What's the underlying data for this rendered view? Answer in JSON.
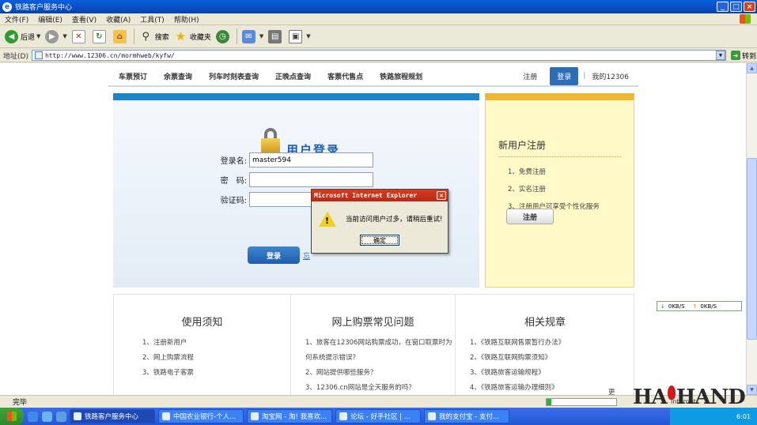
{
  "window": {
    "title": "铁路客户服务中心"
  },
  "menu": [
    "文件(F)",
    "编辑(E)",
    "查看(V)",
    "收藏(A)",
    "工具(T)",
    "帮助(H)"
  ],
  "toolbar": {
    "back": "后退",
    "search": "搜索",
    "favorites": "收藏夹"
  },
  "address": {
    "label": "地址(D)",
    "url": "http://www.12306.cn/mormhweb/kyfw/",
    "go": "转到"
  },
  "site_nav": {
    "items": [
      "车票预订",
      "余票查询",
      "列车时刻表查询",
      "正晚点查询",
      "客票代售点",
      "铁路旅程规划"
    ],
    "register": "注册",
    "login": "登录",
    "divider": "|",
    "my": "我的12306"
  },
  "login": {
    "title": "用户登录",
    "username_label": "登录名:",
    "username_value": "master594",
    "password_label": "密　码:",
    "captcha_label": "验证码:",
    "submit": "登录",
    "forgot": "忘"
  },
  "register_panel": {
    "title": "新用户注册",
    "steps": [
      "1、免费注册",
      "2、实名注册",
      "3、注册用户可享受个性化服务"
    ],
    "button": "注册"
  },
  "info": {
    "col1": {
      "title": "使用须知",
      "items": [
        "1、注册新用户",
        "2、网上购票流程",
        "3、铁路电子客票"
      ]
    },
    "col2": {
      "title": "网上购票常见问题",
      "items": [
        "1、旅客在12306网站购票成功，在窗口取票时为",
        "何系统提示错误？",
        "2、网站提供哪些服务？",
        "3、12306.cn网站是全天服务的吗？"
      ],
      "more": "更多>>"
    },
    "col3": {
      "title": "相关规章",
      "items": [
        "1、《铁路互联网售票暂行办法》",
        "2、《铁路互联网购票须知》",
        "3、《铁路旅客运输规程》",
        "4、《铁路旅客运输办理细则》"
      ]
    }
  },
  "dialog": {
    "title": "Microsoft Internet Explorer",
    "message": "当前访问用户过多，请稍后重试!",
    "ok": "确定"
  },
  "speed": {
    "down": "0KB/S",
    "up": "0KB/S"
  },
  "status": {
    "text": "完毕",
    "zone": "Internet"
  },
  "taskbar": {
    "tasks": [
      "铁路客户服务中心",
      "中国农业银行-个人...",
      "淘宝网 - 淘! 我喜欢...",
      "论坛 - 好手社区 | ...",
      "我的支付宝 - 支付..."
    ],
    "clock": "6:01"
  },
  "watermark": {
    "text_left": "HA",
    "text_right": "HAND"
  }
}
